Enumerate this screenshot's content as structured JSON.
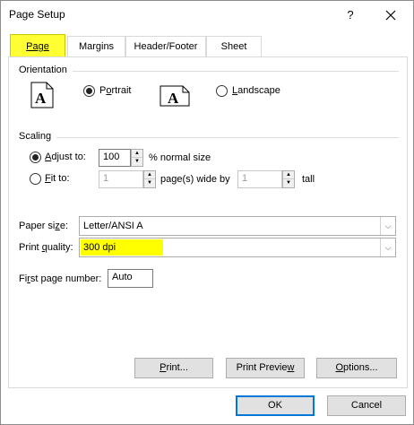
{
  "window": {
    "title": "Page Setup",
    "help": "?"
  },
  "tabs": [
    {
      "label": "Page",
      "active": true
    },
    {
      "label": "Margins",
      "active": false
    },
    {
      "label": "Header/Footer",
      "active": false
    },
    {
      "label": "Sheet",
      "active": false
    }
  ],
  "orientation": {
    "label": "Orientation",
    "portrait": {
      "pre": "P",
      "u": "o",
      "post": "rtrait",
      "checked": true
    },
    "landscape": {
      "pre": "",
      "u": "L",
      "post": "andscape",
      "checked": false
    }
  },
  "scaling": {
    "label": "Scaling",
    "adjust": {
      "pre": "",
      "u": "A",
      "post": "djust to:",
      "value": "100",
      "suffix": "% normal size",
      "checked": true
    },
    "fit": {
      "pre": "",
      "u": "F",
      "post": "it to:",
      "wide_value": "1",
      "wide_label": "page(s) wide by",
      "tall_value": "1",
      "tall_label": "tall",
      "checked": false
    }
  },
  "paper_size": {
    "pre": "Paper si",
    "u": "z",
    "post": "e:",
    "value": "Letter/ANSI A"
  },
  "print_quality": {
    "pre": "Print ",
    "u": "q",
    "post": "uality:",
    "value": "300 dpi"
  },
  "first_page": {
    "pre": "Fi",
    "u": "r",
    "post": "st page number:",
    "value": "Auto"
  },
  "buttons": {
    "print": {
      "pre": "",
      "u": "P",
      "post": "rint..."
    },
    "preview": {
      "pre": "Print Previe",
      "u": "w",
      "post": ""
    },
    "options": {
      "pre": "",
      "u": "O",
      "post": "ptions..."
    },
    "ok": "OK",
    "cancel": "Cancel"
  },
  "colors": {
    "highlight": "#ffff00",
    "accent": "#0078d7"
  }
}
